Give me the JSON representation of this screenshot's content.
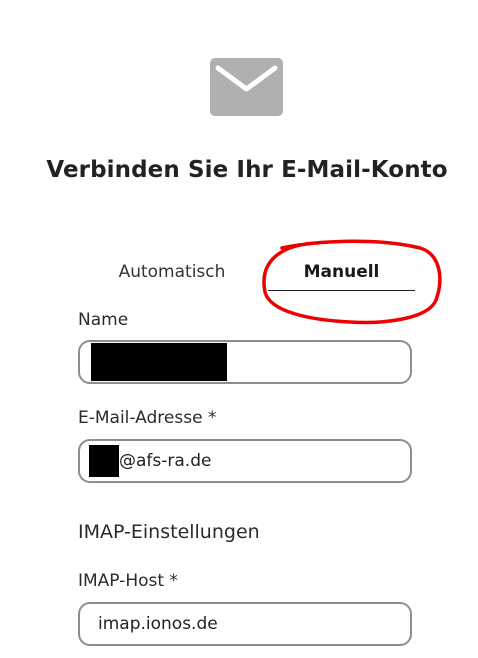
{
  "header": {
    "icon": "mail-icon",
    "title": "Verbinden Sie Ihr E-Mail-Konto"
  },
  "tabs": [
    {
      "label": "Automatisch",
      "selected": false
    },
    {
      "label": "Manuell",
      "selected": true
    }
  ],
  "form": {
    "name": {
      "label": "Name",
      "value": ""
    },
    "email": {
      "label": "E-Mail-Adresse *",
      "value_suffix": "@afs-ra.de"
    },
    "imap_section": "IMAP-Einstellungen",
    "imap_host": {
      "label": "IMAP-Host *",
      "value": "imap.ionos.de"
    }
  },
  "colors": {
    "icon": "#b0b0b0",
    "annotation": "#ee0000",
    "input_border": "#8e8e8e"
  }
}
